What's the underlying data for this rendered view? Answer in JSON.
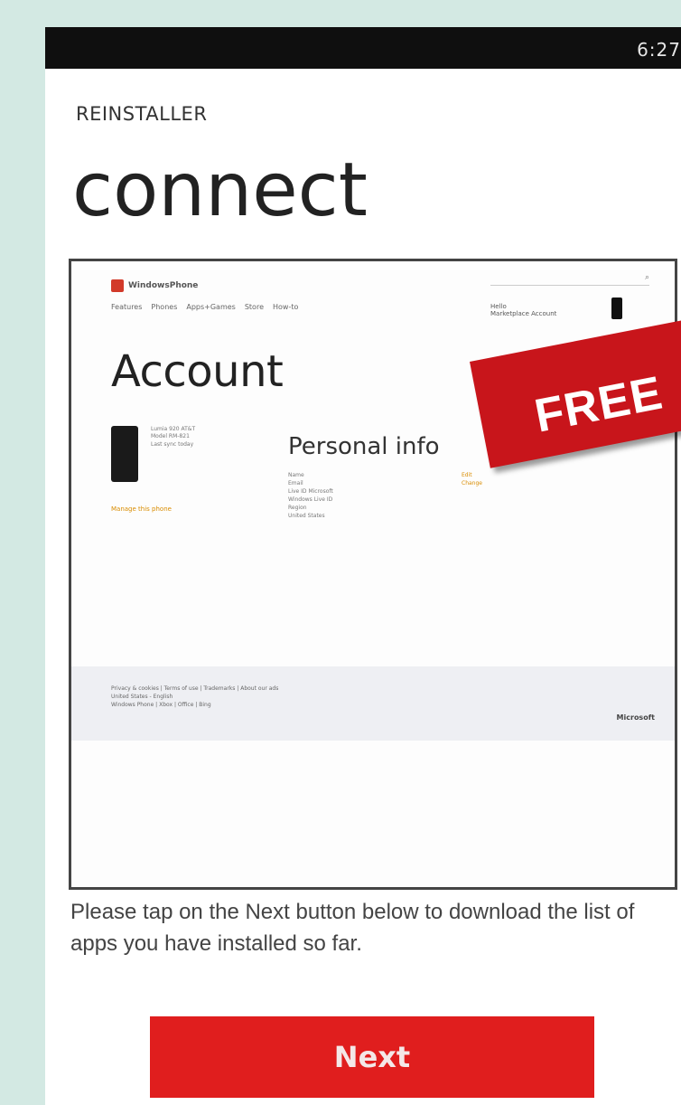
{
  "status_bar": {
    "time": "6:27"
  },
  "app": {
    "title": "REINSTALLER"
  },
  "page": {
    "title": "connect"
  },
  "browser_preview": {
    "logo_text": "WindowsPhone",
    "nav_items": [
      "Features",
      "Phones",
      "Apps+Games",
      "Store",
      "How-to"
    ],
    "user_lines": [
      "Hello",
      "Marketplace Account"
    ],
    "account_heading": "Account",
    "device_lines": [
      "Lumia 920 AT&T",
      "Model RM-821",
      "Last sync today"
    ],
    "manage_link": "Manage this phone",
    "personal_info_heading": "Personal info",
    "info_labels": [
      "Name",
      "Email",
      "Live ID Microsoft",
      "Windows Live ID",
      "Region",
      "United States"
    ],
    "info_values": [
      "Edit",
      "Change"
    ],
    "footer_links": [
      "Privacy & cookies | Terms of use | Trademarks | About our ads",
      "United States - English"
    ],
    "footer_line2": "Windows Phone | Xbox | Office | Bing",
    "footer_brand": "Microsoft"
  },
  "overlay_banner": {
    "text": "FREE",
    "color": "#c8151b"
  },
  "instructions": "Please tap on the Next button below to download the list of apps you have installed so far.",
  "next_button": {
    "label": "Next",
    "color": "#e01e1e"
  }
}
